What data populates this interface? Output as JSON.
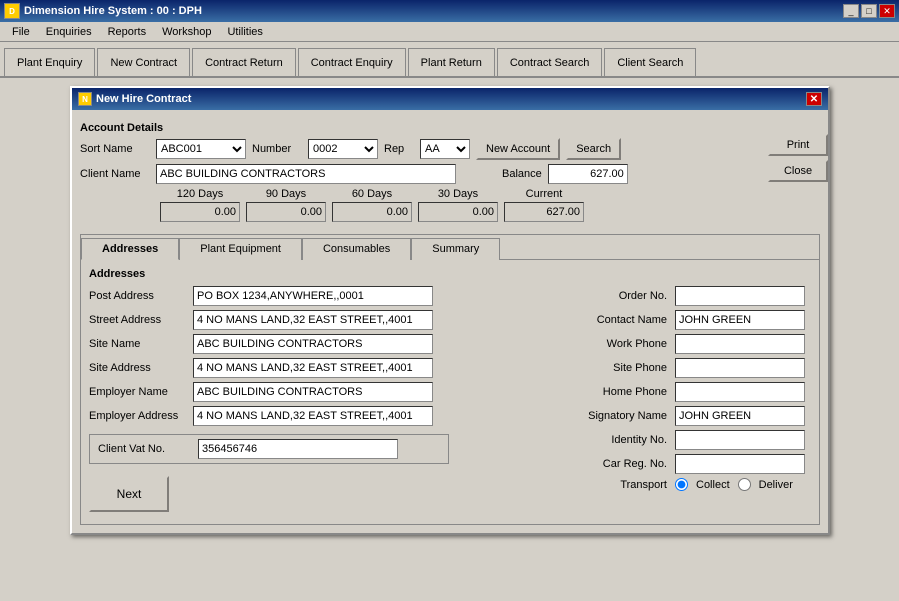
{
  "titlebar": {
    "text": "Dimension Hire System  :  00 : DPH",
    "icon": "D"
  },
  "titlebar_buttons": {
    "minimize": "_",
    "maximize": "□",
    "close": "✕"
  },
  "menu": {
    "items": [
      "File",
      "Enquiries",
      "Reports",
      "Workshop",
      "Utilities"
    ]
  },
  "toolbar": {
    "tabs": [
      "Plant Enquiry",
      "New Contract",
      "Contract Return",
      "Contract Enquiry",
      "Plant Return",
      "Contract Search",
      "Client Search"
    ]
  },
  "dialog": {
    "title": "New Hire Contract",
    "icon": "N"
  },
  "account_details": {
    "label": "Account Details",
    "sort_name_label": "Sort Name",
    "sort_name_value": "ABC001",
    "number_label": "Number",
    "number_value": "0002",
    "rep_label": "Rep",
    "rep_value": "AA",
    "new_account_label": "New Account",
    "search_label": "Search",
    "client_name_label": "Client Name",
    "client_name_value": "ABC BUILDING CONTRACTORS",
    "balance_label": "Balance",
    "balance_value": "627.00",
    "print_label": "Print",
    "close_label": "Close"
  },
  "days": {
    "labels": [
      "120 Days",
      "90 Days",
      "60 Days",
      "30 Days",
      "Current"
    ],
    "values": [
      "0.00",
      "0.00",
      "0.00",
      "0.00",
      "627.00"
    ]
  },
  "tabs": {
    "items": [
      "Addresses",
      "Plant Equipment",
      "Consumables",
      "Summary"
    ],
    "active": 0
  },
  "addresses": {
    "section_label": "Addresses",
    "fields": [
      {
        "label": "Post Address",
        "value": "PO BOX 1234,ANYWHERE,,0001"
      },
      {
        "label": "Street Address",
        "value": "4 NO MANS LAND,32 EAST STREET,,4001"
      },
      {
        "label": "Site Name",
        "value": "ABC BUILDING CONTRACTORS"
      },
      {
        "label": "Site Address",
        "value": "4 NO MANS LAND,32 EAST STREET,,4001"
      },
      {
        "label": "Employer Name",
        "value": "ABC BUILDING CONTRACTORS"
      },
      {
        "label": "Employer Address",
        "value": "4 NO MANS LAND,32 EAST STREET,,4001"
      }
    ],
    "right_fields": [
      {
        "label": "Order No.",
        "value": ""
      },
      {
        "label": "Contact Name",
        "value": "JOHN GREEN"
      },
      {
        "label": "Work Phone",
        "value": ""
      },
      {
        "label": "Site Phone",
        "value": ""
      },
      {
        "label": "Home Phone",
        "value": ""
      },
      {
        "label": "Signatory Name",
        "value": "JOHN GREEN"
      },
      {
        "label": "Identity No.",
        "value": ""
      },
      {
        "label": "Car Reg. No.",
        "value": ""
      }
    ],
    "transport_label": "Transport",
    "transport_options": [
      "Collect",
      "Deliver"
    ],
    "transport_selected": "Collect",
    "vat_label": "Client Vat No.",
    "vat_value": "356456746"
  },
  "next_button": {
    "label": "Next"
  }
}
